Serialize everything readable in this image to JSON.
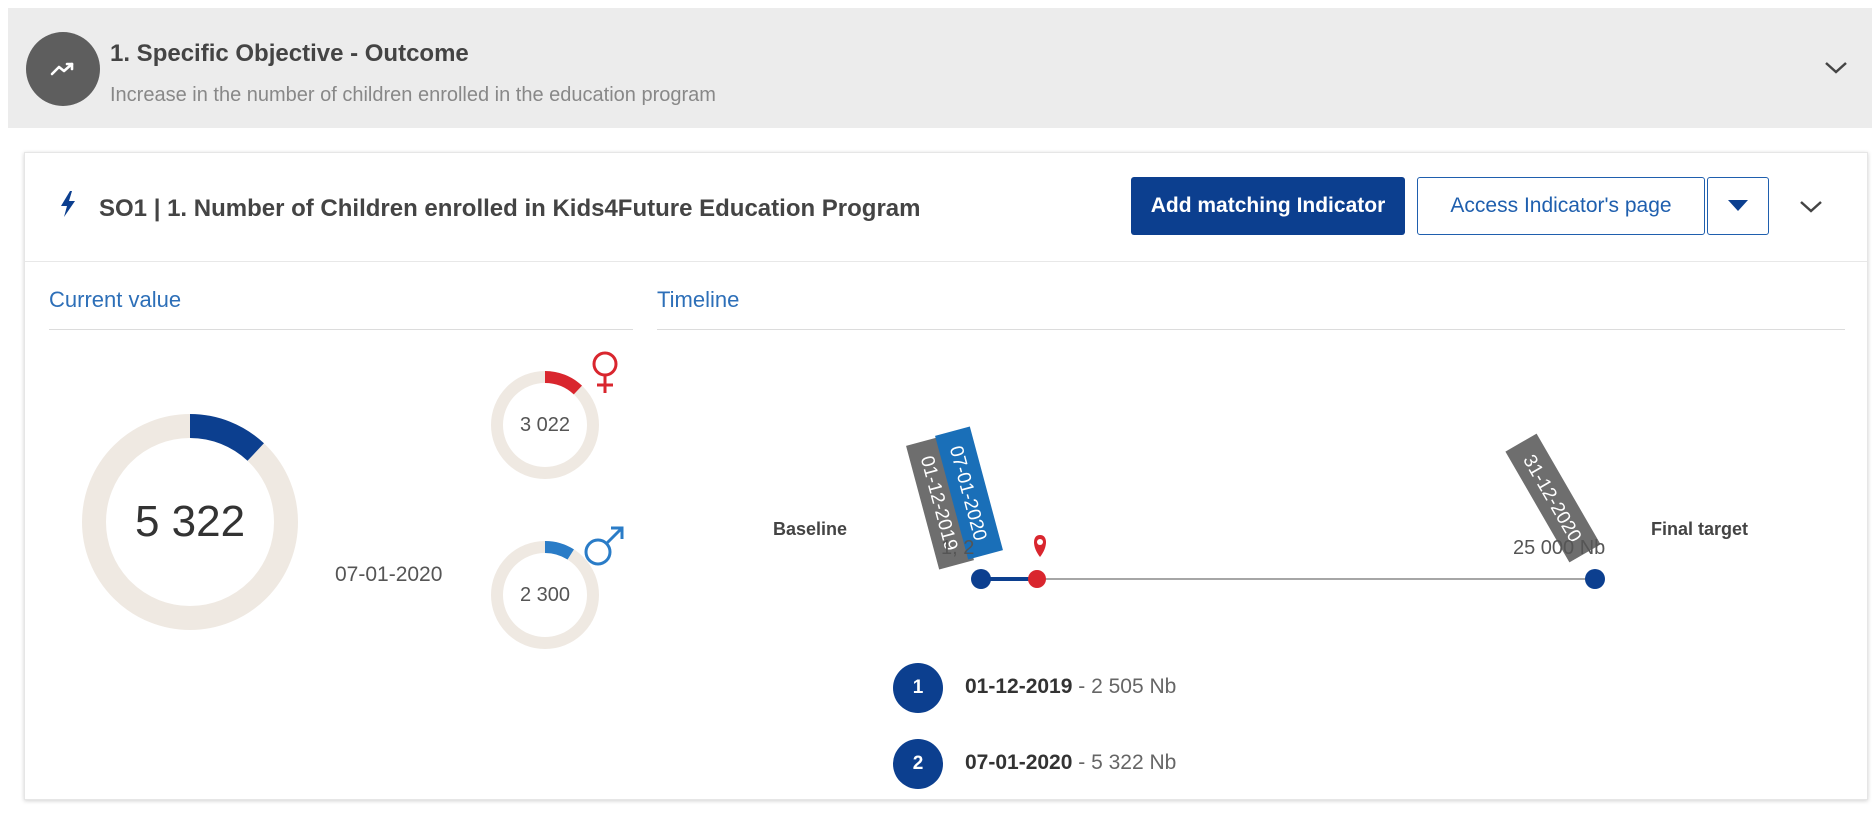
{
  "objective": {
    "icon": "trending-up-icon",
    "title": "1. Specific Objective - Outcome",
    "subtitle": "Increase in the number of children enrolled in the education program"
  },
  "indicator": {
    "icon": "bolt-icon",
    "title": "SO1 | 1. Number of Children enrolled in Kids4Future Education Program",
    "add_button": "Add matching Indicator",
    "access_button": "Access Indicator's page"
  },
  "current_value": {
    "section_label": "Current value",
    "total": "5 322",
    "total_progress": 0.12,
    "date": "07-01-2020",
    "female": {
      "value": "3 022",
      "progress": 0.12,
      "icon": "female-symbol-icon",
      "color": "#d9262e"
    },
    "male": {
      "value": "2 300",
      "progress": 0.09,
      "icon": "male-symbol-icon",
      "color": "#2a7cc7"
    }
  },
  "timeline": {
    "section_label": "Timeline",
    "baseline_label": "Baseline",
    "baseline_value": "1, 2",
    "final_label": "Final target",
    "final_value": "25 000 Nb",
    "tags": {
      "first": "01-12-2019",
      "second": "07-01-2020",
      "target": "31-12-2020"
    },
    "legend": [
      {
        "num": "1",
        "date": "01-12-2019",
        "value": " - 2 505 Nb"
      },
      {
        "num": "2",
        "date": "07-01-2020",
        "value": " - 5 322 Nb"
      }
    ]
  },
  "colors": {
    "primary": "#0c3f8f",
    "accent_blue": "#2d6fb8",
    "female": "#d9262e",
    "male": "#2a7cc7",
    "ring_bg": "#efe9e2"
  }
}
